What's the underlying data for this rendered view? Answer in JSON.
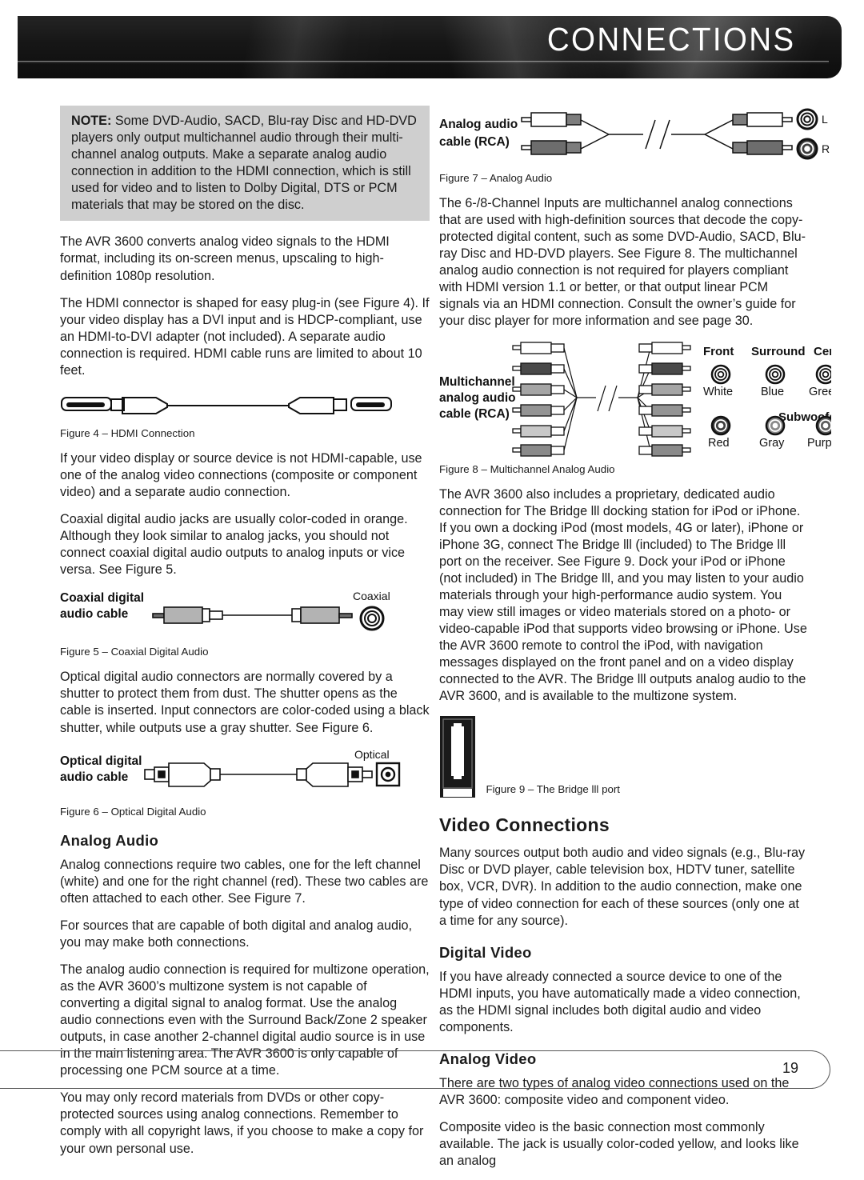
{
  "header": {
    "title": "CONNECTIONS"
  },
  "note": {
    "lead": "NOTE:",
    "text": " Some DVD-Audio, SACD, Blu-ray Disc and HD-DVD players only output multichannel audio through their multi-channel analog outputs. Make a separate analog audio connection in addition to the HDMI connection, which is still used for video and to listen to Dolby Digital, DTS or PCM materials that may be stored on the disc."
  },
  "left_column": {
    "p1": "The AVR 3600 converts analog video signals to the HDMI format, including its on-screen menus, upscaling to high-definition 1080p resolution.",
    "p2": "The HDMI connector is shaped for easy plug-in (see Figure 4). If your video display has a DVI input and is HDCP-compliant, use an HDMI-to-DVI adapter (not included). A separate audio connection is required. HDMI cable runs are limited to about 10 feet.",
    "fig4_caption": "Figure 4 – HDMI Connection",
    "p3": "If your video display or source device is not HDMI-capable, use one of the analog video connections (composite or component video) and a separate audio connection.",
    "p4": "Coaxial digital audio jacks are usually color-coded in orange. Although they look similar to analog jacks, you should not connect coaxial digital audio outputs to analog inputs or vice versa. See Figure 5.",
    "fig5_label_line1": "Coaxial digital",
    "fig5_label_line2": "audio cable",
    "fig5_jack_label": "Coaxial",
    "fig5_caption": "Figure 5 – Coaxial Digital Audio",
    "p5": "Optical digital audio connectors are normally covered by a shutter to protect them from dust. The shutter opens as the cable is inserted. Input connectors are color-coded using a black shutter, while outputs use a gray shutter. See Figure 6.",
    "fig6_label_line1": "Optical digital",
    "fig6_label_line2": "audio cable",
    "fig6_jack_label": "Optical",
    "fig6_caption": "Figure 6 – Optical Digital Audio",
    "heading_analog_audio": "Analog Audio",
    "p6": "Analog connections require two cables, one for the left channel (white) and one for the right channel (red). These two cables are often attached to each other. See Figure 7.",
    "p7": "For sources that are capable of both digital and analog audio, you may make both connections.",
    "p8": "The analog audio connection is required for multizone operation, as the AVR 3600’s multizone system is not capable of converting a digital signal to analog format. Use the analog audio connections even with the Surround Back/Zone 2 speaker outputs, in case another 2-channel digital audio source is in use in the main listening area. The AVR 3600 is only capable of processing one PCM source at a time.",
    "p9": "You may only record materials from DVDs or other copy-protected sources using analog connections. Remember to comply with all copyright laws, if you choose to make a copy for your own personal use."
  },
  "right_column": {
    "fig7_label_line1": "Analog audio",
    "fig7_label_line2": "cable (RCA)",
    "fig7_jack_L": "L",
    "fig7_jack_R": "R",
    "fig7_caption": "Figure 7 – Analog Audio",
    "p1": "The 6-/8-Channel Inputs are multichannel analog connections that are used with high-definition sources that decode the copy-protected digital content, such as some DVD-Audio, SACD, Blu-ray Disc and HD-DVD players. See Figure 8. The multichannel analog audio connection is not required for players compliant with HDMI version 1.1 or better, or that output linear PCM signals via an HDMI connection. Consult the owner’s guide for your disc player for more information and see page 30.",
    "fig8_label_line1": "Multichannel",
    "fig8_label_line2": "analog audio",
    "fig8_label_line3": "cable (RCA)",
    "fig8_jack_groups": [
      {
        "name": "Front",
        "color_name": "White",
        "swatch": "#ffffff"
      },
      {
        "name": "Surround",
        "color_name": "Blue",
        "swatch": "#ffffff"
      },
      {
        "name": "Center",
        "color_name": "Green",
        "swatch": "#ffffff"
      },
      {
        "name": "",
        "color_name": "Red",
        "swatch": "#3a3a3a"
      },
      {
        "name": "",
        "color_name": "Gray",
        "swatch": "#8a8a8a"
      },
      {
        "name": "Subwoofer",
        "color_name": "Purple",
        "swatch": "#6a6a6a"
      }
    ],
    "fig8_caption": "Figure 8 – Multichannel Analog Audio",
    "p2": "The AVR 3600 also includes a proprietary, dedicated audio connection for The Bridge lll docking station for iPod or iPhone. If you own a docking iPod (most models, 4G or later), iPhone or iPhone 3G, connect The Bridge lll (included) to The Bridge lll port on the receiver. See Figure 9. Dock your iPod or iPhone (not included) in The Bridge lll, and you may listen to your audio materials through your high-performance audio system. You may view still images or video materials stored on a photo- or video-capable iPod that supports video browsing or iPhone. Use the AVR 3600 remote to control the iPod, with navigation messages displayed on the front panel and on a video display connected to the AVR. The Bridge lll outputs analog audio to the AVR 3600, and is available to the multizone system.",
    "fig9_caption": "Figure 9 –  The Bridge lll port",
    "heading_video_connections": "Video Connections",
    "p3": "Many sources output both audio and video signals (e.g., Blu-ray Disc or DVD player, cable television box, HDTV tuner, satellite box, VCR, DVR). In addition to the audio connection, make one type of video connection for each of these sources (only one at a time for any source).",
    "heading_digital_video": "Digital Video",
    "p4": "If you have already connected a source device to one of the HDMI inputs, you have automatically made a video connection, as the HDMI signal includes both digital audio and video components.",
    "heading_analog_video": "Analog Video",
    "p5": "There are two types of analog video connections used on the AVR 3600: composite video and component video.",
    "p6": "Composite video is the basic connection most commonly available. The jack is usually color-coded yellow, and looks like an analog"
  },
  "footer": {
    "page_number": "19"
  }
}
